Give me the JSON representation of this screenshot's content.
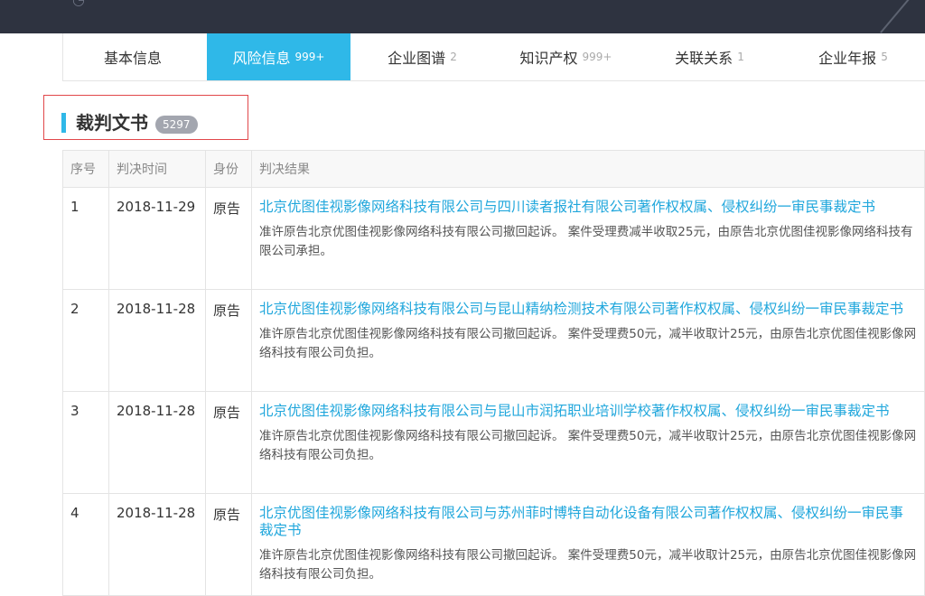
{
  "tabs": [
    {
      "label": "基本信息",
      "count": ""
    },
    {
      "label": "风险信息",
      "count": "999+"
    },
    {
      "label": "企业图谱",
      "count": "2"
    },
    {
      "label": "知识产权",
      "count": "999+"
    },
    {
      "label": "关联关系",
      "count": "1"
    },
    {
      "label": "企业年报",
      "count": "5"
    }
  ],
  "active_tab": 1,
  "section": {
    "title": "裁判文书",
    "count": "5297"
  },
  "table": {
    "headers": {
      "index": "序号",
      "date": "判决时间",
      "role": "身份",
      "result": "判决结果"
    },
    "rows": [
      {
        "index": "1",
        "date": "2018-11-29",
        "role": "原告",
        "title": "北京优图佳视影像网络科技有限公司与四川读者报社有限公司著作权权属、侵权纠纷一审民事裁定书",
        "summary": "准许原告北京优图佳视影像网络科技有限公司撤回起诉。 案件受理费减半收取25元，由原告北京优图佳视影像网络科技有限公司承担。"
      },
      {
        "index": "2",
        "date": "2018-11-28",
        "role": "原告",
        "title": "北京优图佳视影像网络科技有限公司与昆山精纳检测技术有限公司著作权权属、侵权纠纷一审民事裁定书",
        "summary": "准许原告北京优图佳视影像网络科技有限公司撤回起诉。 案件受理费50元，减半收取计25元，由原告北京优图佳视影像网络科技有限公司负担。"
      },
      {
        "index": "3",
        "date": "2018-11-28",
        "role": "原告",
        "title": "北京优图佳视影像网络科技有限公司与昆山市润拓职业培训学校著作权权属、侵权纠纷一审民事裁定书",
        "summary": "准许原告北京优图佳视影像网络科技有限公司撤回起诉。 案件受理费50元，减半收取计25元，由原告北京优图佳视影像网络科技有限公司负担。"
      },
      {
        "index": "4",
        "date": "2018-11-28",
        "role": "原告",
        "title": "北京优图佳视影像网络科技有限公司与苏州菲时博特自动化设备有限公司著作权权属、侵权纠纷一审民事裁定书",
        "summary": "准许原告北京优图佳视影像网络科技有限公司撤回起诉。 案件受理费50元，减半收取计25元，由原告北京优图佳视影像网络科技有限公司负担。"
      }
    ]
  },
  "colors": {
    "accent": "#2fb8e8",
    "link": "#21a7dc",
    "highlight_border": "#e1474a",
    "header_bg": "#2e3340"
  }
}
